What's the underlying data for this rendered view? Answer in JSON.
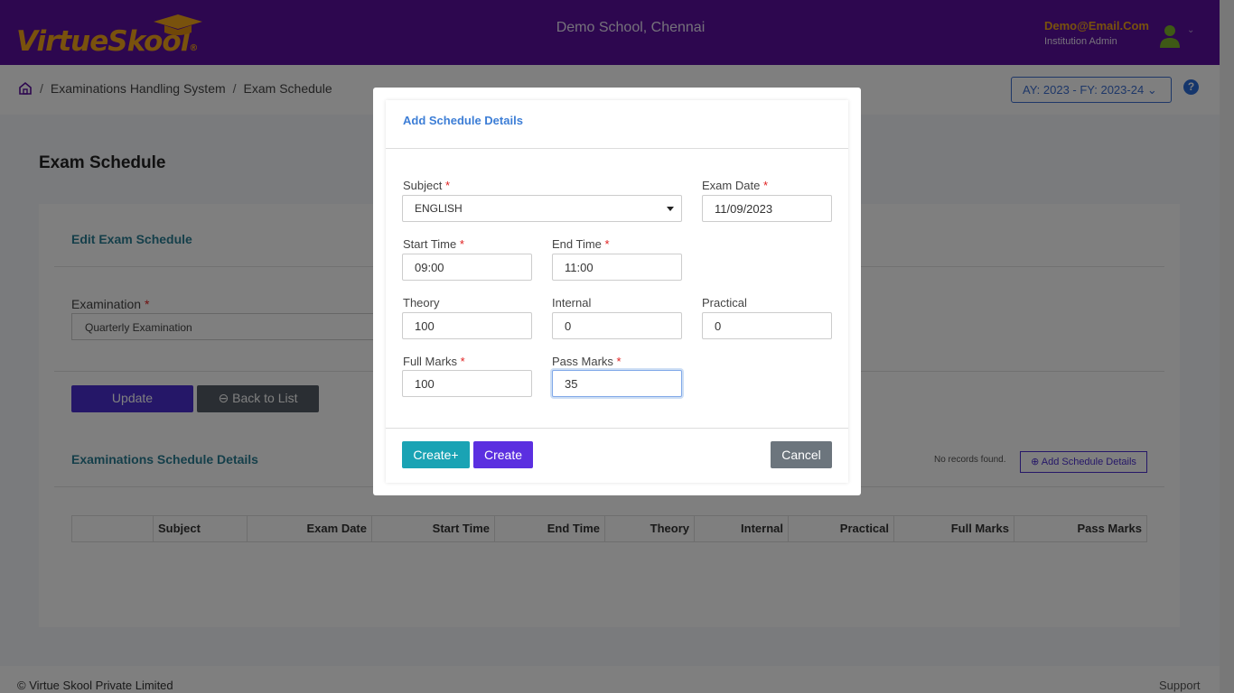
{
  "header": {
    "logo_text_virtue": "Virtue",
    "logo_text_skool": "Skool",
    "logo_reg": "®",
    "school_name": "Demo School, Chennai",
    "user_email": "Demo@Email.Com",
    "user_role": "Institution Admin"
  },
  "breadcrumb": {
    "items": [
      "Examinations Handling System",
      "Exam Schedule"
    ],
    "sep": "/"
  },
  "academic_year": "AY: 2023 - FY: 2023-24",
  "help": "?",
  "page": {
    "title": "Exam Schedule",
    "edit_section_title": "Edit Exam Schedule",
    "examination_label": "Examination",
    "examination_value": "Quarterly Examination",
    "update_label": "Update",
    "back_label": "Back to List",
    "schedule_section_title": "Examinations Schedule Details",
    "no_records": "No records found.",
    "add_schedule_label": "Add Schedule Details",
    "table_headers": [
      "",
      "Subject",
      "Exam Date",
      "Start Time",
      "End Time",
      "Theory",
      "Internal",
      "Practical",
      "Full Marks",
      "Pass Marks"
    ]
  },
  "footer": {
    "copyright": "© Virtue Skool Private Limited",
    "support": "Support"
  },
  "modal": {
    "title": "Add Schedule Details",
    "required_mark": "*",
    "subject_label": "Subject",
    "subject_value": "ENGLISH",
    "exam_date_label": "Exam Date",
    "exam_date_value": "11/09/2023",
    "start_time_label": "Start Time",
    "start_time_value": "09:00",
    "end_time_label": "End Time",
    "end_time_value": "11:00",
    "theory_label": "Theory",
    "theory_value": "100",
    "internal_label": "Internal",
    "internal_value": "0",
    "practical_label": "Practical",
    "practical_value": "0",
    "full_marks_label": "Full Marks",
    "full_marks_value": "100",
    "pass_marks_label": "Pass Marks",
    "pass_marks_value": "35",
    "create_plus_label": "Create+",
    "create_label": "Create",
    "cancel_label": "Cancel"
  }
}
